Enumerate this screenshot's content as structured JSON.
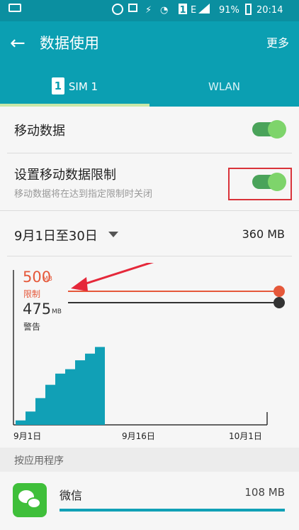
{
  "status_bar": {
    "battery_percent": "91%",
    "time": "20:14",
    "network_type": "E",
    "sim_slot": "1"
  },
  "app_bar": {
    "title": "数据使用",
    "more_label": "更多"
  },
  "tabs": [
    {
      "label": "SIM 1",
      "badge": "1",
      "selected": true
    },
    {
      "label": "WLAN",
      "selected": false
    }
  ],
  "settings": {
    "mobile_data": {
      "label": "移动数据",
      "enabled": true
    },
    "limit": {
      "label": "设置移动数据限制",
      "description": "移动数据将在达到指定限制时关闭",
      "enabled": true
    }
  },
  "period": {
    "label": "9月1日至30日",
    "total": "360 MB"
  },
  "chart_data": {
    "type": "area",
    "x_ticks": [
      "9月1日",
      "9月16日",
      "10月1日"
    ],
    "limit": {
      "value": "500",
      "unit": "MB",
      "label": "限制",
      "color": "#e5583a"
    },
    "warning": {
      "value": "475",
      "unit": "MB",
      "label": "警告",
      "color": "#333333"
    },
    "series_color": "#11a0b6",
    "x": [
      1,
      2,
      3,
      4,
      5,
      6,
      7,
      8,
      9,
      10
    ],
    "y": [
      20,
      60,
      120,
      180,
      230,
      250,
      290,
      320,
      350,
      360
    ],
    "ylim": [
      0,
      600
    ]
  },
  "section": {
    "header": "按应用程序"
  },
  "apps": [
    {
      "name": "微信",
      "usage": "108 MB"
    }
  ],
  "colors": {
    "status_bar": "#0b8fa0",
    "app_bar": "#0b9fb2",
    "toggle_on": "#4aa35a",
    "annotation_red": "#d9333a"
  }
}
